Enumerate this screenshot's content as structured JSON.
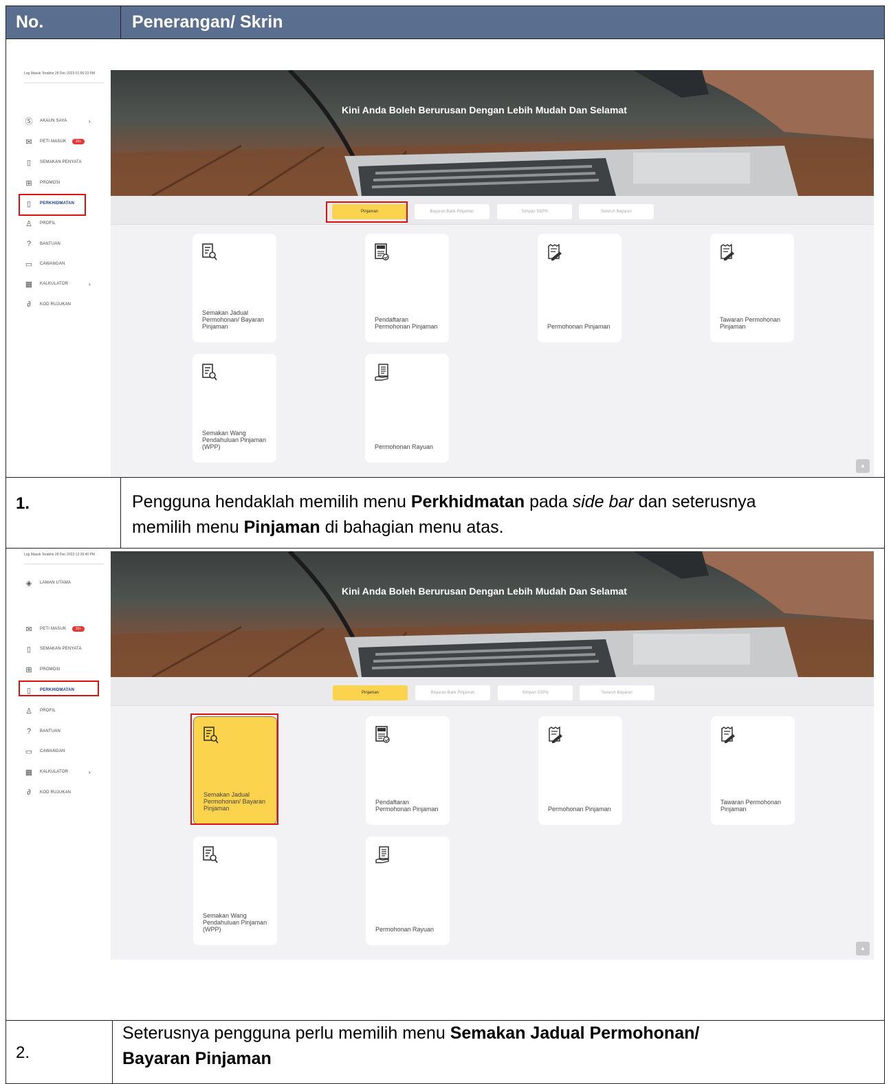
{
  "header": {
    "col1": "No.",
    "col2": "Penerangan/ Skrin"
  },
  "app": {
    "banner_title": "Kini Anda Boleh Berurusan Dengan Lebih Mudah Dan Selamat",
    "tabs": [
      "Pinjaman",
      "Bayaran Balik Pinjaman",
      "Simpan SSPN",
      "Seluruh Bayaran"
    ],
    "cards": [
      "Semakan Jadual Permohonan/ Bayaran Pinjaman",
      "Pendaftaran Permohonan Pinjaman",
      "Permohonan Pinjaman",
      "Tawaran Permohonan Pinjaman",
      "Semakan Wang Pendahuluan Pinjaman (WPP)",
      "Permohonan Rayuan"
    ],
    "badge": "10+",
    "scroll_top": "▲"
  },
  "shot1": {
    "last_login": "Log Masuk Terakhir 28 Dec 2023 01:56:23 PM",
    "menu": [
      "AKAUN SAYA",
      "PETI MASUK",
      "SEMAKAN PENYATA",
      "PROMOSI",
      "PERKHIDMATAN",
      "PROFIL",
      "BANTUAN",
      "CAWANGAN",
      "KALKULATOR",
      "KOD RUJUKAN"
    ]
  },
  "shot2": {
    "last_login": "Log Masuk Terakhir 28 Dec 2023 12:39:40 PM",
    "menu": [
      "LAMAN UTAMA",
      "PETI MASUK",
      "SEMAKAN PENYATA",
      "PROMOSI",
      "PERKHIDMATAN",
      "PROFIL",
      "BANTUAN",
      "CAWANGAN",
      "KALKULATOR",
      "KOD RUJUKAN"
    ]
  },
  "step1": {
    "no": "1.",
    "t1": "Pengguna hendaklah memilih menu ",
    "b1": "Perkhidmatan",
    "t2": " pada ",
    "i1": "side bar",
    "t3": " dan seterusnya",
    "t4": "memilih menu ",
    "b2": "Pinjaman",
    "t5": " di bahagian menu atas."
  },
  "step2": {
    "no": "2.",
    "t1": "Seterusnya pengguna perlu memilih menu ",
    "b1": "Semakan Jadual Permohonan/",
    "b2": "Bayaran Pinjaman"
  },
  "colors": {
    "header_bg": "#5a6f90",
    "accent_yellow": "#fcd34d",
    "highlight_red": "#e01010",
    "badge_red": "#e53935",
    "active_menu": "#1e3a8a"
  }
}
